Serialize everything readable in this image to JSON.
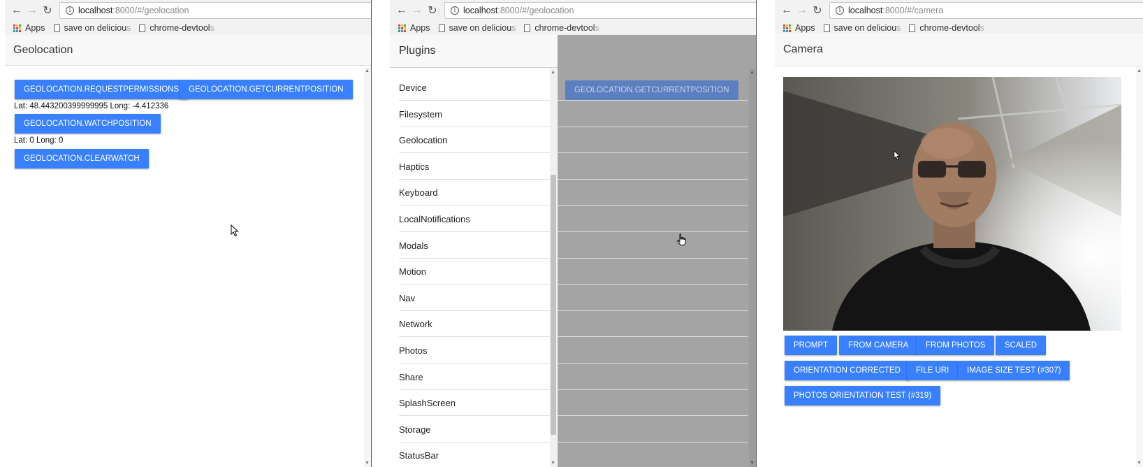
{
  "panels": {
    "left": {
      "toolbar": {
        "url_host": "localhost",
        "url_rest": ":8000/#/geolocation"
      },
      "bookmarks": {
        "apps": "Apps",
        "bm1": "save on deliciou",
        "bm1_fade": "s",
        "bm2": "chrome-devtool",
        "bm2_fade": "s"
      },
      "header_title": "Geolocation",
      "buttons": {
        "request_permissions": "GEOLOCATION.REQUESTPERMISSIONS",
        "get_current_position": "GEOLOCATION.GETCURRENTPOSITION",
        "watch_position": "GEOLOCATION.WATCHPOSITION",
        "clear_watch": "GEOLOCATION.CLEARWATCH"
      },
      "current_position_text": "Lat: 48.443200399999995 Long: -4.412336",
      "watch_position_text": "Lat: 0 Long: 0"
    },
    "middle": {
      "toolbar": {
        "url_host": "localhost",
        "url_rest": ":8000/#/geolocation"
      },
      "bookmarks": {
        "apps": "Apps",
        "bm1": "save on deliciou",
        "bm1_fade": "s",
        "bm2": "chrome-devtool",
        "bm2_fade": "s"
      },
      "menu_title": "Plugins",
      "menu_items": [
        "Device",
        "Filesystem",
        "Geolocation",
        "Haptics",
        "Keyboard",
        "LocalNotifications",
        "Modals",
        "Motion",
        "Nav",
        "Network",
        "Photos",
        "Share",
        "SplashScreen",
        "Storage",
        "StatusBar"
      ],
      "overlay_button": "GEOLOCATION.GETCURRENTPOSITION"
    },
    "right": {
      "toolbar": {
        "url_host": "localhost",
        "url_rest": ":8000/#/camera"
      },
      "bookmarks": {
        "apps": "Apps",
        "bm1": "save on deliciou",
        "bm1_fade": "s",
        "bm2": "chrome-devtool",
        "bm2_fade": "s"
      },
      "header_title": "Camera",
      "buttons": {
        "prompt": "PROMPT",
        "from_camera": "FROM CAMERA",
        "from_photos": "FROM PHOTOS",
        "scaled": "SCALED",
        "orientation_corrected": "ORIENTATION CORRECTED",
        "file_uri": "FILE URI",
        "image_size_test": "IMAGE SIZE TEST (#307)",
        "photos_orientation_test": "PHOTOS ORIENTATION TEST (#319)"
      }
    }
  },
  "colors": {
    "button_blue": "#3880ff",
    "overlay_grey": "#a4a4a4",
    "toolbar_grey": "#f2f2f2"
  },
  "icons": [
    "back-arrow-icon",
    "forward-arrow-icon",
    "reload-icon",
    "info-icon",
    "apps-grid-icon",
    "page-icon",
    "mouse-pointer-icon",
    "hand-pointer-icon"
  ]
}
